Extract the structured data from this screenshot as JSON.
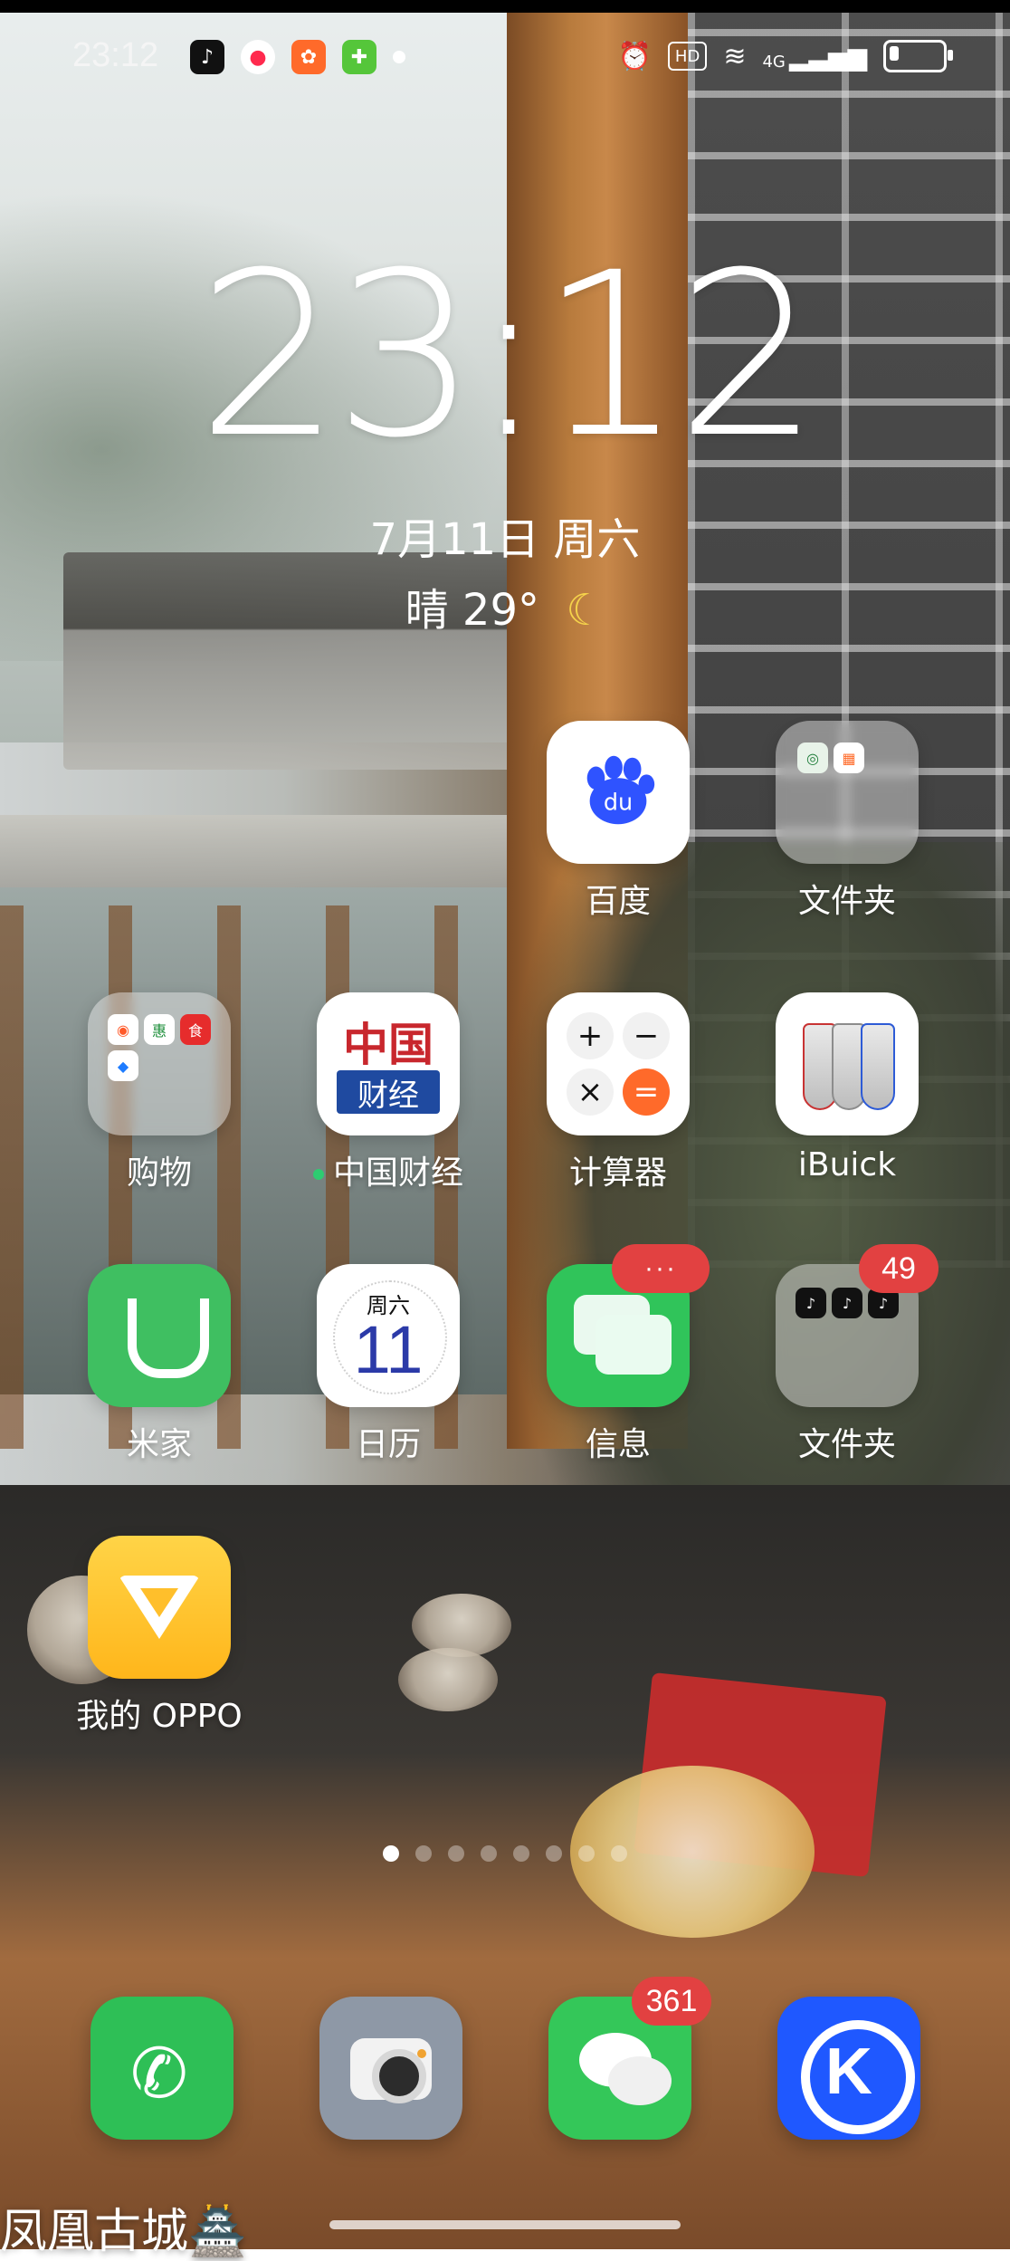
{
  "status_bar": {
    "time": "23:12",
    "notifications": [
      {
        "icon": "tiktok-icon",
        "glyph": "♪"
      },
      {
        "icon": "red-circle-app-icon",
        "glyph": "●"
      },
      {
        "icon": "orange-app-icon",
        "glyph": "✿"
      },
      {
        "icon": "green-app-icon",
        "glyph": "✚"
      },
      {
        "icon": "more-dot-icon",
        "glyph": ""
      }
    ],
    "system": {
      "alarm_glyph": "⏰",
      "hd_label": "HD",
      "wifi_glyph": "≋",
      "signal_label": "4G",
      "signal_glyph": "▂▃▅▆",
      "battery_level": 0.18
    }
  },
  "clock_widget": {
    "time": "23:12",
    "date": "7月11日  周六",
    "weather": "晴 29°",
    "weather_glyph": "☾"
  },
  "apps": [
    {
      "id": "baidu",
      "label": "百度"
    },
    {
      "id": "folder-1",
      "label": "文件夹"
    },
    {
      "id": "shopping",
      "label": "购物"
    },
    {
      "id": "china-finance",
      "label": "中国财经",
      "icon_text_top": "中国",
      "icon_text_bottom": "财经"
    },
    {
      "id": "calculator",
      "label": "计算器",
      "keys": [
        "+",
        "−",
        "×",
        "="
      ]
    },
    {
      "id": "ibuick",
      "label": "iBuick"
    },
    {
      "id": "mijia",
      "label": "米家"
    },
    {
      "id": "calendar",
      "label": "日历",
      "weekday": "周六",
      "day": "11"
    },
    {
      "id": "messages",
      "label": "信息",
      "badge": "···"
    },
    {
      "id": "folder-2",
      "label": "文件夹",
      "badge": "49"
    },
    {
      "id": "my-oppo",
      "label": "我的 OPPO"
    }
  ],
  "page_indicator": {
    "count": 8,
    "active_index": 0
  },
  "dock": [
    {
      "id": "phone",
      "glyph": "✆"
    },
    {
      "id": "camera"
    },
    {
      "id": "wechat",
      "badge": "361"
    },
    {
      "id": "kuwo",
      "glyph": "K"
    }
  ],
  "wallpaper_caption": "凤凰古城🏯"
}
